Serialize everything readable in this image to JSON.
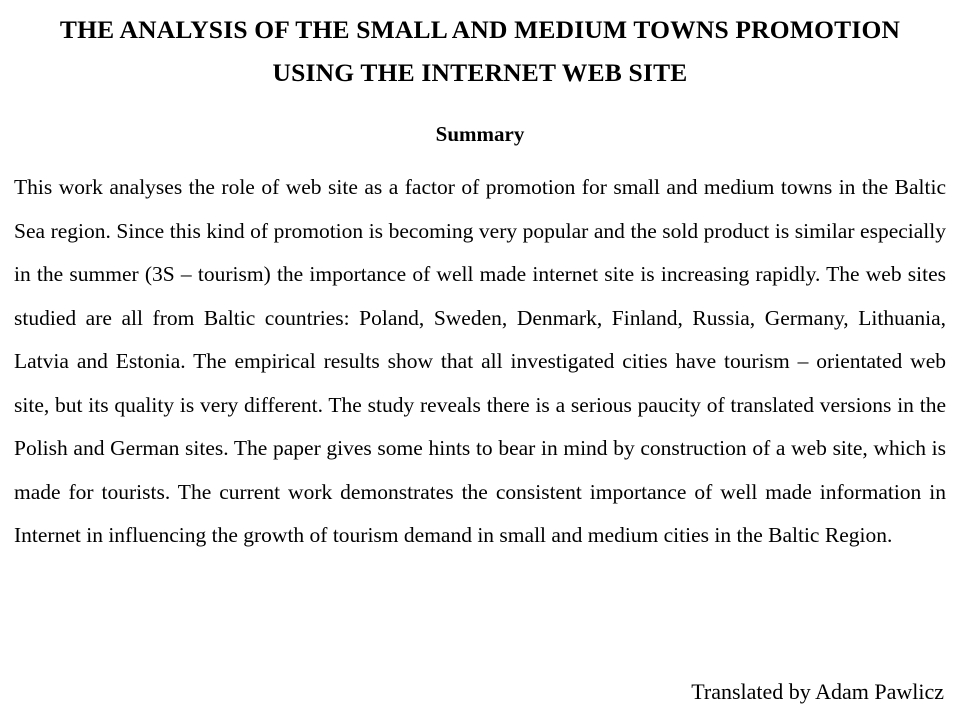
{
  "document": {
    "title_lines": [
      "THE ANALYSIS OF THE SMALL AND MEDIUM TOWNS PROMOTION",
      "USING THE INTERNET WEB SITE"
    ],
    "summary_heading": "Summary",
    "body": "This work analyses the role of web site as a factor of promotion for small and medium towns in the Baltic Sea region. Since this kind of promotion is becoming very popular and the sold product is similar especially in the summer (3S – tourism) the importance of well made internet site is increasing rapidly. The web sites studied are all from Baltic countries: Poland, Sweden, Denmark, Finland, Russia, Germany, Lithuania, Latvia and Estonia. The empirical results show that all investigated cities have tourism – orientated web site, but its quality is very different. The study reveals there is a serious paucity of translated versions in the Polish and German sites. The paper gives some hints to bear in mind by construction of a web site, which is made for tourists. The current work demonstrates the consistent importance of well made information in Internet in influencing the growth of tourism demand in small and medium cities in the Baltic Region.",
    "signature": "Translated by Adam Pawlicz"
  }
}
